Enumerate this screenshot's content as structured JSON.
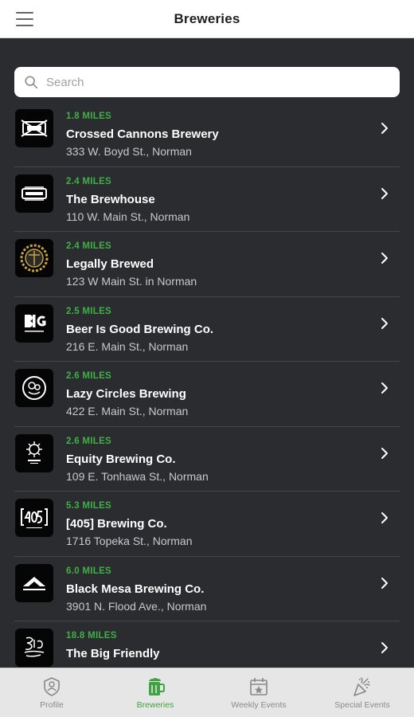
{
  "header": {
    "title": "Breweries",
    "menu_icon": "hamburger-menu-icon"
  },
  "search": {
    "placeholder": "Search"
  },
  "colors": {
    "accent": "#3fb046",
    "background": "#2b2c30",
    "header": "#ffffff",
    "tabbar": "#e6e6e6"
  },
  "breweries": [
    {
      "distance": "1.8 MILES",
      "name": "Crossed Cannons Brewery",
      "address": "333 W. Boyd St., Norman",
      "logo": "crossed-cannons-logo"
    },
    {
      "distance": "2.4 MILES",
      "name": "The Brewhouse",
      "address": "110 W. Main St., Norman",
      "logo": "brewhouse-logo"
    },
    {
      "distance": "2.4 MILES",
      "name": "Legally Brewed",
      "address": "123 W Main St. in Norman",
      "logo": "legally-brewed-logo"
    },
    {
      "distance": "2.5 MILES",
      "name": "Beer Is Good Brewing Co.",
      "address": "216 E. Main St., Norman",
      "logo": "big-logo"
    },
    {
      "distance": "2.6 MILES",
      "name": "Lazy Circles Brewing",
      "address": "422 E. Main St., Norman",
      "logo": "lazy-circles-logo"
    },
    {
      "distance": "2.6 MILES",
      "name": "Equity Brewing Co.",
      "address": "109 E. Tonhawa St., Norman",
      "logo": "equity-logo"
    },
    {
      "distance": "5.3 MILES",
      "name": "[405] Brewing Co.",
      "address": "1716 Topeka St., Norman",
      "logo": "405-logo"
    },
    {
      "distance": "6.0 MILES",
      "name": "Black Mesa Brewing Co.",
      "address": "3901 N. Flood Ave., Norman",
      "logo": "black-mesa-logo"
    },
    {
      "distance": "18.8 MILES",
      "name": "The Big Friendly",
      "address": "",
      "logo": "big-friendly-logo"
    }
  ],
  "tabs": [
    {
      "label": "Profile",
      "icon": "profile-badge-icon",
      "active": false
    },
    {
      "label": "Breweries",
      "icon": "beer-mug-icon",
      "active": true
    },
    {
      "label": "Weekly Events",
      "icon": "calendar-star-icon",
      "active": false
    },
    {
      "label": "Special Events",
      "icon": "party-popper-icon",
      "active": false
    }
  ]
}
